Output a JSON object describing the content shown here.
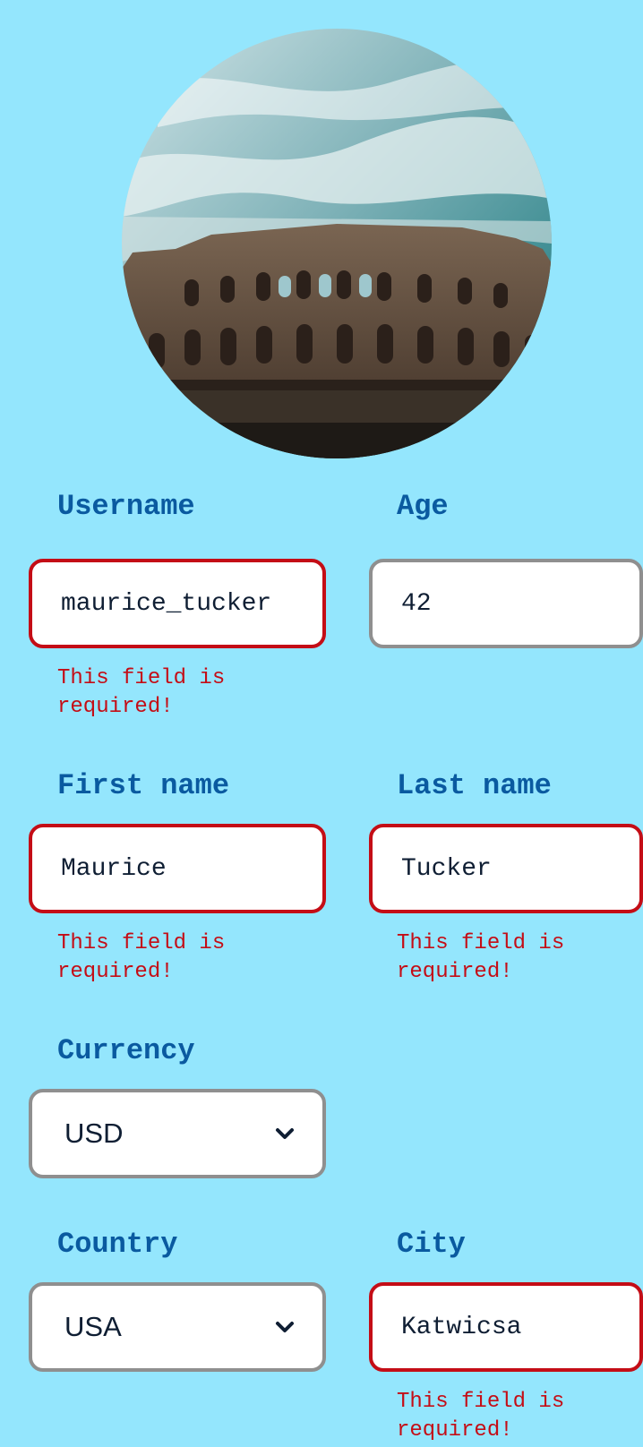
{
  "fields": {
    "username": {
      "label": "Username",
      "value": "maurice_tucker",
      "error": "This field is required!"
    },
    "age": {
      "label": "Age",
      "value": "42"
    },
    "first_name": {
      "label": "First name",
      "value": "Maurice",
      "error": "This field is required!"
    },
    "last_name": {
      "label": "Last name",
      "value": "Tucker",
      "error": "This field is required!"
    },
    "currency": {
      "label": "Currency",
      "value": "USD"
    },
    "country": {
      "label": "Country",
      "value": "USA"
    },
    "city": {
      "label": "City",
      "value": "Katwicsa",
      "error": "This field is required!"
    }
  },
  "icons": {
    "dropdown": "chevron-down-icon",
    "avatar": "colosseum-photo"
  },
  "colors": {
    "background": "#94e6fd",
    "label": "#0a5aa0",
    "error": "#c40d16",
    "neutral_border": "#8f8f8f"
  }
}
